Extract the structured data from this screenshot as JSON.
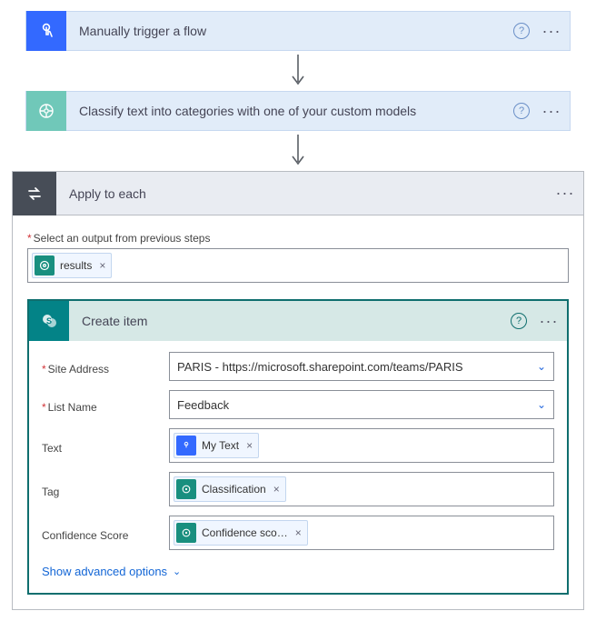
{
  "cards": {
    "trigger": {
      "title": "Manually trigger a flow"
    },
    "classify": {
      "title": "Classify text into categories with one of your custom models"
    },
    "applyEach": {
      "title": "Apply to each"
    },
    "createItem": {
      "title": "Create item"
    }
  },
  "applyBody": {
    "outputLabel": "Select an output from previous steps",
    "outputToken": "results"
  },
  "createItemForm": {
    "siteAddress": {
      "label": "Site Address",
      "value": "PARIS - https://microsoft.sharepoint.com/teams/PARIS"
    },
    "listName": {
      "label": "List Name",
      "value": "Feedback"
    },
    "text": {
      "label": "Text",
      "token": "My Text"
    },
    "tag": {
      "label": "Tag",
      "token": "Classification"
    },
    "confidence": {
      "label": "Confidence Score",
      "token": "Confidence sco…"
    },
    "advanced": "Show advanced options"
  }
}
